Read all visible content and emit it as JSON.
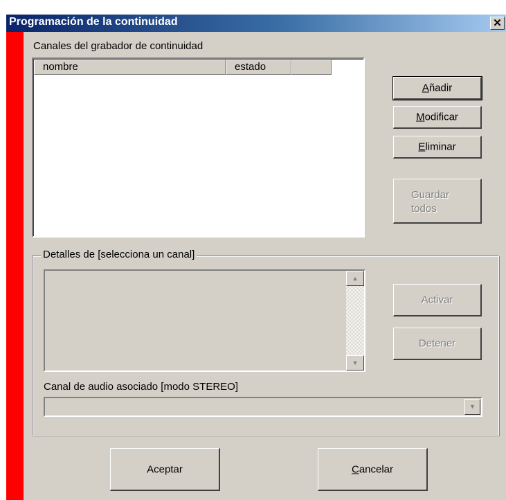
{
  "window": {
    "title": "Programación de la continuidad",
    "close_glyph": "✕"
  },
  "channels": {
    "group_label": "Canales del grabador de continuidad",
    "columns": [
      "nombre",
      "estado",
      ""
    ],
    "rows": []
  },
  "buttons": {
    "add": {
      "pre": "",
      "key": "A",
      "post": "ñadir"
    },
    "modify": {
      "pre": "",
      "key": "M",
      "post": "odificar"
    },
    "delete": {
      "pre": "",
      "key": "E",
      "post": "liminar"
    },
    "save_all": {
      "line1": "Guardar",
      "line2": "todos"
    },
    "activate": "Activar",
    "stop": "Detener",
    "accept": "Aceptar",
    "cancel": {
      "pre": "",
      "key": "C",
      "post": "ancelar"
    }
  },
  "details": {
    "legend": "Detalles de [selecciona un canal]",
    "text": "",
    "scroll_up_icon": "▲",
    "scroll_down_icon": "▼"
  },
  "audio": {
    "label": "Canal de audio asociado [modo STEREO]",
    "selected_value": "",
    "dropdown_icon": "▼"
  },
  "colors": {
    "accent_bar": "#ff0000",
    "title_gradient_start": "#0a246a",
    "face": "#d4d0c8"
  }
}
